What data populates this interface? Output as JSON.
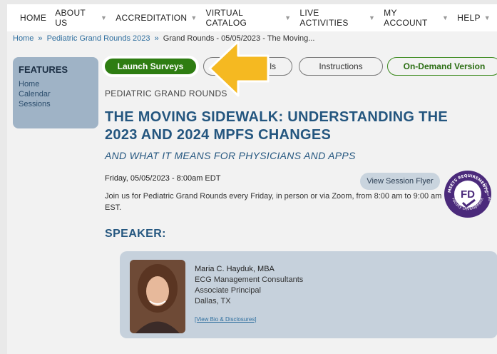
{
  "nav": {
    "items": [
      {
        "label": "HOME",
        "dropdown": false
      },
      {
        "label": "ABOUT US",
        "dropdown": true
      },
      {
        "label": "ACCREDITATION",
        "dropdown": true
      },
      {
        "label": "VIRTUAL CATALOG",
        "dropdown": true
      },
      {
        "label": "LIVE ACTIVITIES",
        "dropdown": true
      },
      {
        "label": "MY ACCOUNT",
        "dropdown": true
      },
      {
        "label": "HELP",
        "dropdown": true
      }
    ]
  },
  "breadcrumb": {
    "home": "Home",
    "sep": "»",
    "parent": "Pediatric Grand Rounds 2023",
    "current": "Grand Rounds - 05/05/2023 - The Moving..."
  },
  "features": {
    "title": "FEATURES",
    "links": [
      "Home",
      "Calendar",
      "Sessions"
    ]
  },
  "buttons": {
    "launch": "Launch Surveys",
    "details": "Details",
    "instructions": "Instructions",
    "on_demand": "On-Demand Version"
  },
  "session": {
    "eyebrow": "PEDIATRIC GRAND ROUNDS",
    "title": "THE MOVING SIDEWALK: UNDERSTANDING THE 2023 AND 2024 MPFS CHANGES",
    "subtitle": "AND WHAT IT MEANS FOR PHYSICIANS AND APPS",
    "date": "Friday, 05/05/2023 - 8:00am EDT",
    "flyer_button": "View Session Flyer",
    "description": "Join us for Pediatric Grand Rounds every Friday, in person or via Zoom, from 8:00 am to 9:00 am EST."
  },
  "badge": {
    "center": "FD",
    "ring_top": "MEETS REQUIREMENTS",
    "ring_bottom": "Faculty Development",
    "ring_right": "Click for More"
  },
  "speaker": {
    "heading": "SPEAKER:",
    "name": "Maria C. Hayduk, MBA",
    "org": "ECG Management Consultants",
    "role": "Associate Principal",
    "location": "Dallas, TX",
    "bio_link": "[View Bio & Disclosures]"
  },
  "colors": {
    "accent_green": "#2e7d12",
    "heading_blue": "#24567f",
    "arrow_yellow": "#f5b921",
    "badge_purple": "#4b2a7b"
  }
}
